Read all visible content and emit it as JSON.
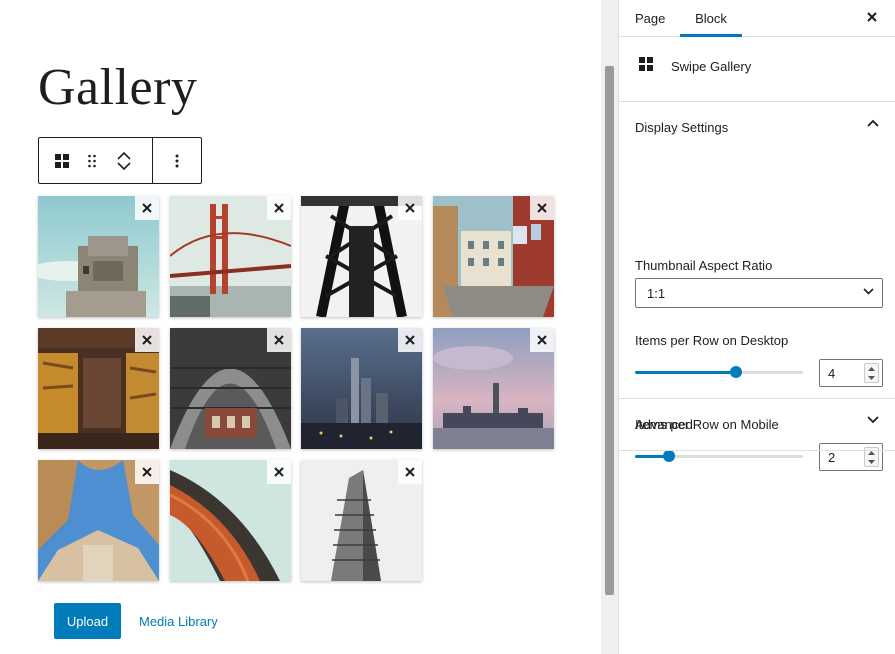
{
  "page": {
    "title": "Gallery"
  },
  "toolbar": {
    "block_icon": "grid-icon",
    "drag_icon": "drag-handle-icon",
    "move_up_icon": "chevron-up-icon",
    "move_down_icon": "chevron-down-icon",
    "more_icon": "more-vertical-icon"
  },
  "gallery": {
    "remove_icon": "close-icon",
    "images": [
      {
        "name": "concrete-bunker"
      },
      {
        "name": "golden-gate-bridge"
      },
      {
        "name": "steel-tower"
      },
      {
        "name": "street-with-laundry"
      },
      {
        "name": "rusty-doors"
      },
      {
        "name": "arched-hall-ceiling"
      },
      {
        "name": "city-skyline-dusk"
      },
      {
        "name": "skyline-pink-sky"
      },
      {
        "name": "courtyard-looking-up"
      },
      {
        "name": "curved-red-building"
      },
      {
        "name": "flatiron-building"
      }
    ]
  },
  "actions": {
    "upload_label": "Upload",
    "media_library_label": "Media Library"
  },
  "sidebar": {
    "tabs": [
      {
        "label": "Page"
      },
      {
        "label": "Block"
      }
    ],
    "active_tab": "Block",
    "close_icon": "close-icon",
    "block": {
      "icon": "grid-icon",
      "name": "Swipe Gallery"
    },
    "display_settings": {
      "title": "Display Settings",
      "thumbnail_ratio_label": "Thumbnail Aspect Ratio",
      "thumbnail_ratio_value": "1:1",
      "desktop_label": "Items per Row on Desktop",
      "desktop_value": "4",
      "desktop_fraction": 0.6,
      "mobile_label": "Items per Row on Mobile",
      "mobile_value": "2",
      "mobile_fraction": 0.2
    },
    "advanced": {
      "title": "Advanced"
    }
  },
  "colors": {
    "accent": "#007cba",
    "text": "#1e1e1e",
    "border": "#e0e0e0"
  }
}
